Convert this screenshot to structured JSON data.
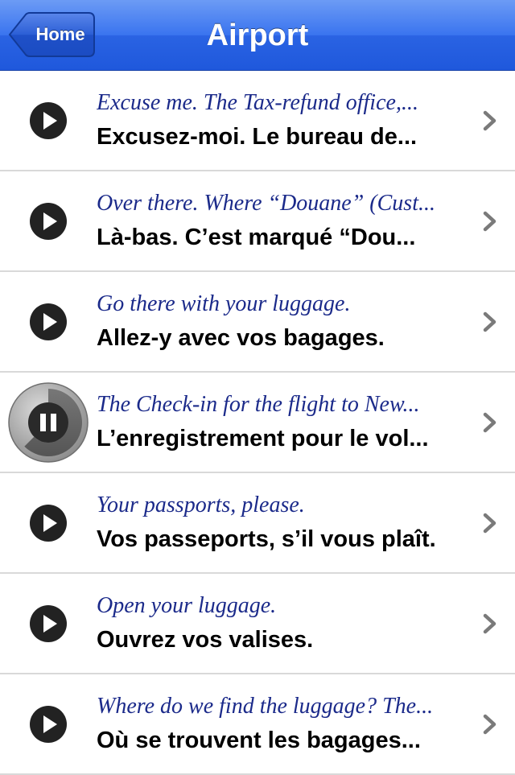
{
  "navbar": {
    "title": "Airport",
    "back_label": "Home"
  },
  "rows": [
    {
      "english": "Excuse me. The Tax-refund office,...",
      "french": "Excusez-moi. Le bureau de...",
      "state": "play"
    },
    {
      "english": "Over there. Where “Douane” (Cust...",
      "french": "Là-bas. C’est marqué “Dou...",
      "state": "play"
    },
    {
      "english": "Go there with your luggage.",
      "french": "Allez-y avec vos bagages.",
      "state": "play"
    },
    {
      "english": "The Check-in for the flight to New...",
      "french": "L’enregistrement pour le vol...",
      "state": "pause"
    },
    {
      "english": "Your passports, please.",
      "french": "Vos passeports, s’il vous plaît.",
      "state": "play"
    },
    {
      "english": "Open your luggage.",
      "french": "Ouvrez vos valises.",
      "state": "play"
    },
    {
      "english": "Where do we find the luggage? The...",
      "french": "Où se trouvent les bagages...",
      "state": "play"
    }
  ],
  "colors": {
    "navbar": "#2a63e3",
    "english_text": "#1b2a8a",
    "french_text": "#000000",
    "separator": "#d9d9d9"
  }
}
